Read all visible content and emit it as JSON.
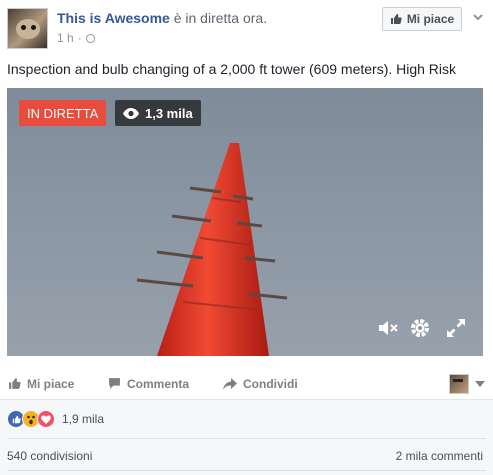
{
  "header": {
    "page_name": "This is Awesome",
    "live_text": "è in diretta ora.",
    "time": "1 h",
    "dot": "·",
    "like_page_label": "Mi piace"
  },
  "post_text": "Inspection and bulb changing of a 2,000 ft tower (609 meters). High Risk",
  "video": {
    "live_badge": "IN DIRETTA",
    "viewers": "1,3 mila",
    "colors": {
      "live_red": "#e74c3c",
      "tower_red": "#e8382a"
    }
  },
  "actions": {
    "like": "Mi piace",
    "comment": "Commenta",
    "share": "Condividi"
  },
  "reactions": {
    "icons": [
      "like-icon",
      "wow-icon",
      "love-icon"
    ],
    "count": "1,9 mila"
  },
  "stats": {
    "shares": "540 condivisioni",
    "comments": "2 mila commenti"
  },
  "colors": {
    "link_blue": "#365899",
    "like_blue": "#4267b2",
    "love_red": "#f25268",
    "wow_yellow": "#f7b125"
  }
}
